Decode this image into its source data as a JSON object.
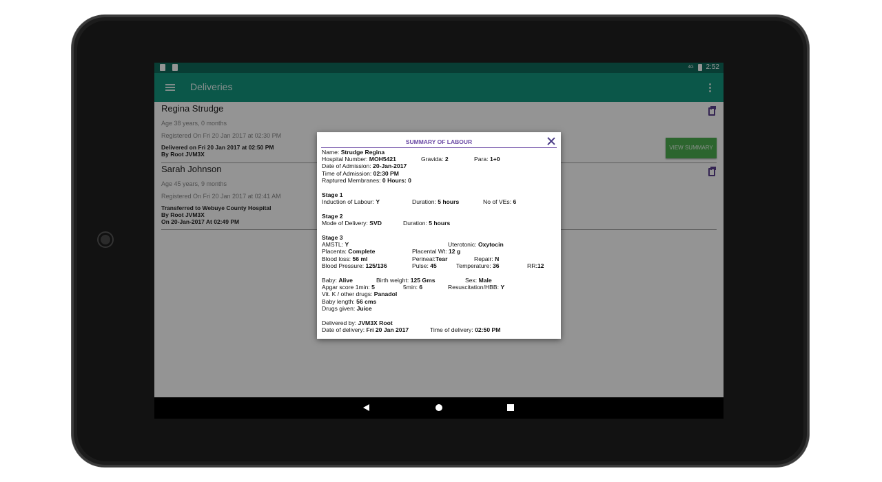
{
  "status_bar": {
    "time": "2:52",
    "signal": "4G"
  },
  "app_bar": {
    "title": "Deliveries"
  },
  "list": [
    {
      "name": "Regina Strudge",
      "age": "Age 38 years, 0 months",
      "registered": "Registered On Fri 20 Jan 2017 at 02:30 PM",
      "status_lines": [
        "Delivered on Fri 20 Jan 2017 at 02:50 PM",
        "By Root JVM3X"
      ],
      "action_label": "VIEW SUMMARY"
    },
    {
      "name": "Sarah Johnson",
      "age": "Age 45 years, 9 months",
      "registered": "Registered On Fri 20 Jan 2017 at 02:41 AM",
      "status_lines": [
        "Transferred to Webuye County Hospital",
        "By Root JVM3X",
        "On 20-Jan-2017 At 02:49 PM"
      ]
    }
  ],
  "dialog": {
    "title": "SUMMARY OF LABOUR",
    "name_label": "Name:",
    "name": "Strudge Regina",
    "hospital_label": "Hospital Number:",
    "hospital": "MOH5421",
    "gravida_label": "Gravida:",
    "gravida": "2",
    "para_label": "Para:",
    "para": "1+0",
    "admission_date_label": "Date of Admission:",
    "admission_date": "20-Jan-2017",
    "admission_time_label": "Time of Admission:",
    "admission_time": "02:30 PM",
    "membranes_label": "Raptured Membranes:",
    "membranes": "0 Hours: 0",
    "stage1": {
      "heading": "Stage 1",
      "induction_label": "Induction of Labour:",
      "induction": "Y",
      "duration_label": "Duration:",
      "duration": "5 hours",
      "ves_label": "No of VEs:",
      "ves": "6"
    },
    "stage2": {
      "heading": "Stage 2",
      "mode_label": "Mode of Delivery:",
      "mode": "SVD",
      "duration_label": "Duration:",
      "duration": "5 hours"
    },
    "stage3": {
      "heading": "Stage 3",
      "amstl_label": "AMSTL:",
      "amstl": "Y",
      "uterotonic_label": "Uterotonic:",
      "uterotonic": "Oxytocin",
      "placenta_label": "Placenta:",
      "placenta": "Complete",
      "placental_wt_label": "Placental Wt:",
      "placental_wt": "12 g",
      "blood_loss_label": "Blood loss:",
      "blood_loss": "56 ml",
      "perineal_label": "Perineal:",
      "perineal": "Tear",
      "repair_label": "Repair:",
      "repair": "N",
      "bp_label": "Blood Pressure:",
      "bp": "125/136",
      "pulse_label": "Pulse:",
      "pulse": "45",
      "temp_label": "Temperature:",
      "temp": "36",
      "rr_label": "RR:",
      "rr": "12"
    },
    "baby": {
      "baby_label": "Baby:",
      "baby": "Alive",
      "weight_label": "Birth weight:",
      "weight": "125 Gms",
      "sex_label": "Sex:",
      "sex": "Male",
      "apgar1_label": "Apgar score 1min:",
      "apgar1": "5",
      "apgar5_label": "5min:",
      "apgar5": "6",
      "resus_label": "Resuscitation/HBB:",
      "resus": "Y",
      "vitk_label": "Vit. K / other drugs:",
      "vitk": "Panadol",
      "length_label": "Baby length:",
      "length": "56 cms",
      "drugs_label": "Drugs given:",
      "drugs": "Juice"
    },
    "delivery": {
      "by_label": "Delivered by:",
      "by": "JVM3X Root",
      "date_label": "Date of delivery:",
      "date": "Fri 20 Jan 2017",
      "time_label": "Time of delivery:",
      "time": "02:50 PM"
    }
  }
}
